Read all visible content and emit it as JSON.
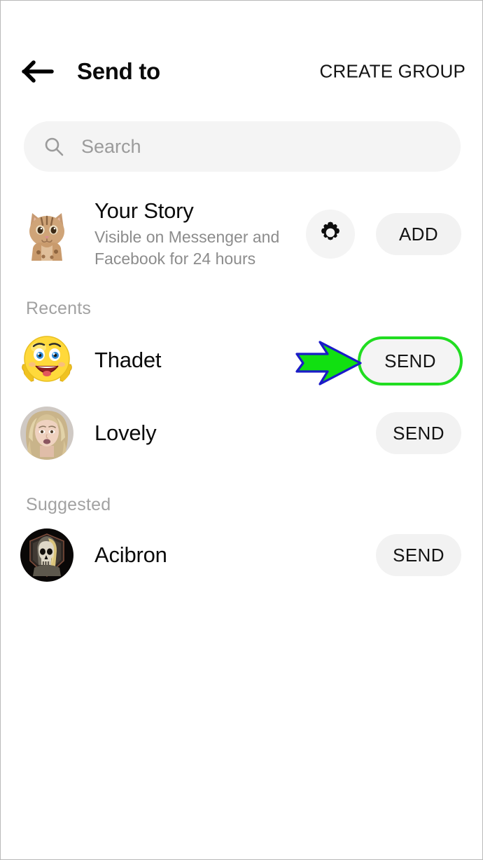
{
  "header": {
    "back_icon": "back-arrow-icon",
    "title": "Send to",
    "create_group_label": "CREATE GROUP"
  },
  "search": {
    "icon": "search-icon",
    "placeholder": "Search",
    "value": ""
  },
  "your_story": {
    "avatar": "cat-photo-avatar",
    "title": "Your Story",
    "subtitle": "Visible on Messenger and Facebook for 24 hours",
    "settings_icon": "gear-icon",
    "add_label": "ADD"
  },
  "sections": [
    {
      "label": "Recents",
      "items": [
        {
          "name": "Thadet",
          "avatar": "smiley-emoji-avatar",
          "action_label": "SEND",
          "highlighted": true
        },
        {
          "name": "Lovely",
          "avatar": "woman-photo-avatar",
          "action_label": "SEND",
          "highlighted": false
        }
      ]
    },
    {
      "label": "Suggested",
      "items": [
        {
          "name": "Acibron",
          "avatar": "skull-photo-avatar",
          "action_label": "SEND",
          "highlighted": false
        }
      ]
    }
  ],
  "annotation": {
    "arrow_icon": "green-right-arrow-annotation",
    "arrow_fill": "#11e011",
    "arrow_stroke": "#1b1bc8",
    "highlight_color": "#21dd21"
  },
  "colors": {
    "background": "#ffffff",
    "pill_background": "#f2f2f2",
    "search_background": "#f4f4f4",
    "primary_text": "#0b0b0b",
    "secondary_text": "#8c8c8c",
    "section_text": "#a2a2a2"
  }
}
